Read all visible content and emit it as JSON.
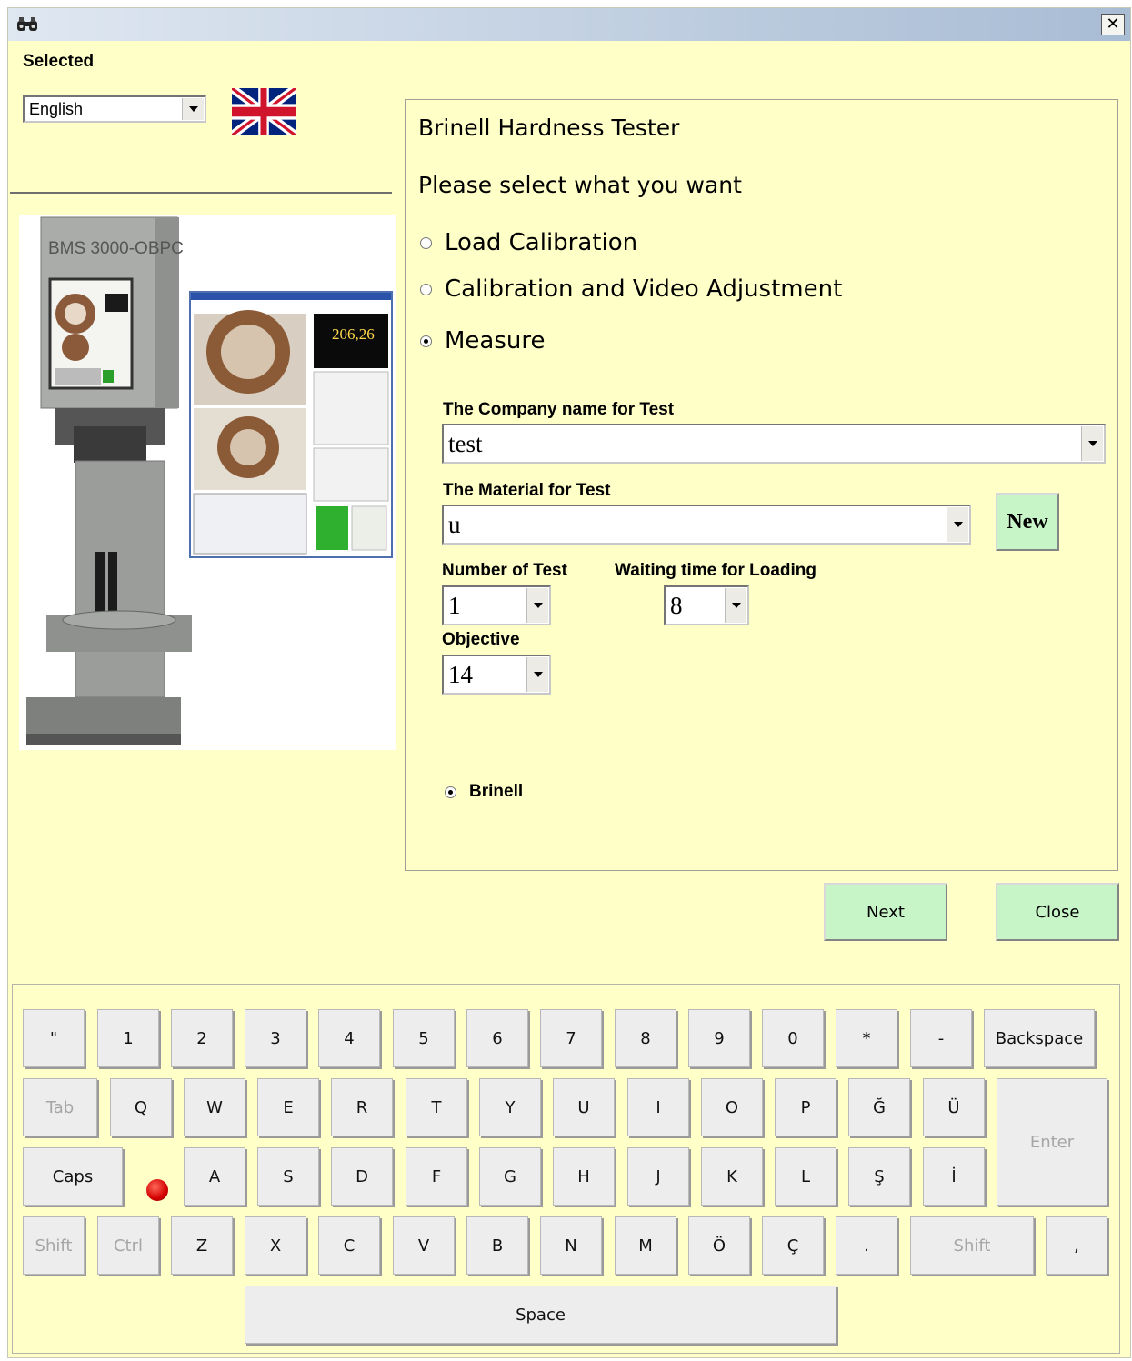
{
  "window": {
    "close_glyph": "✕",
    "title_icon": "binoculars-icon"
  },
  "language": {
    "label": "Selected",
    "selected": "English",
    "flag": "uk-flag-icon"
  },
  "machine_photo": {
    "model_text": "BMS 3000-OBPC",
    "screen_reading": "206,26"
  },
  "panel": {
    "title": "Brinell Hardness Tester",
    "prompt": "Please select what you want",
    "options": [
      {
        "label": "Load Calibration",
        "selected": false
      },
      {
        "label": "Calibration and Video Adjustment",
        "selected": false
      },
      {
        "label": "Measure",
        "selected": true
      }
    ],
    "company_label": "The Company name for Test",
    "company_value": "test",
    "material_label": "The Material for Test",
    "material_value": "u",
    "new_button": "New",
    "number_label": "Number of Test",
    "number_value": "1",
    "waiting_label": "Waiting time for Loading",
    "waiting_value": "8",
    "objective_label": "Objective",
    "objective_value": "14",
    "method_label": "Brinell",
    "method_selected": true
  },
  "buttons": {
    "next": "Next",
    "close": "Close"
  },
  "keyboard": {
    "colors": {
      "key_bg": "#ededed",
      "disabled_text": "#a6a6a6",
      "caps_led": "#d40000"
    },
    "rows": [
      [
        "\"",
        "1",
        "2",
        "3",
        "4",
        "5",
        "6",
        "7",
        "8",
        "9",
        "0",
        "*",
        "-",
        "Backspace"
      ],
      [
        "Tab",
        "Q",
        "W",
        "E",
        "R",
        "T",
        "Y",
        "U",
        "I",
        "O",
        "P",
        "Ğ",
        "Ü",
        "Enter"
      ],
      [
        "Caps",
        "A",
        "S",
        "D",
        "F",
        "G",
        "H",
        "J",
        "K",
        "L",
        "Ş",
        "İ"
      ],
      [
        "Shift",
        "Ctrl",
        "Z",
        "X",
        "C",
        "V",
        "B",
        "N",
        "M",
        "Ö",
        "Ç",
        ".",
        "Shift",
        ","
      ],
      [
        "Space"
      ]
    ],
    "disabled": [
      "Tab",
      "Enter",
      "Shift",
      "Ctrl"
    ]
  },
  "colors": {
    "background": "#ffffc8",
    "button_green": "#c8f5c8"
  }
}
